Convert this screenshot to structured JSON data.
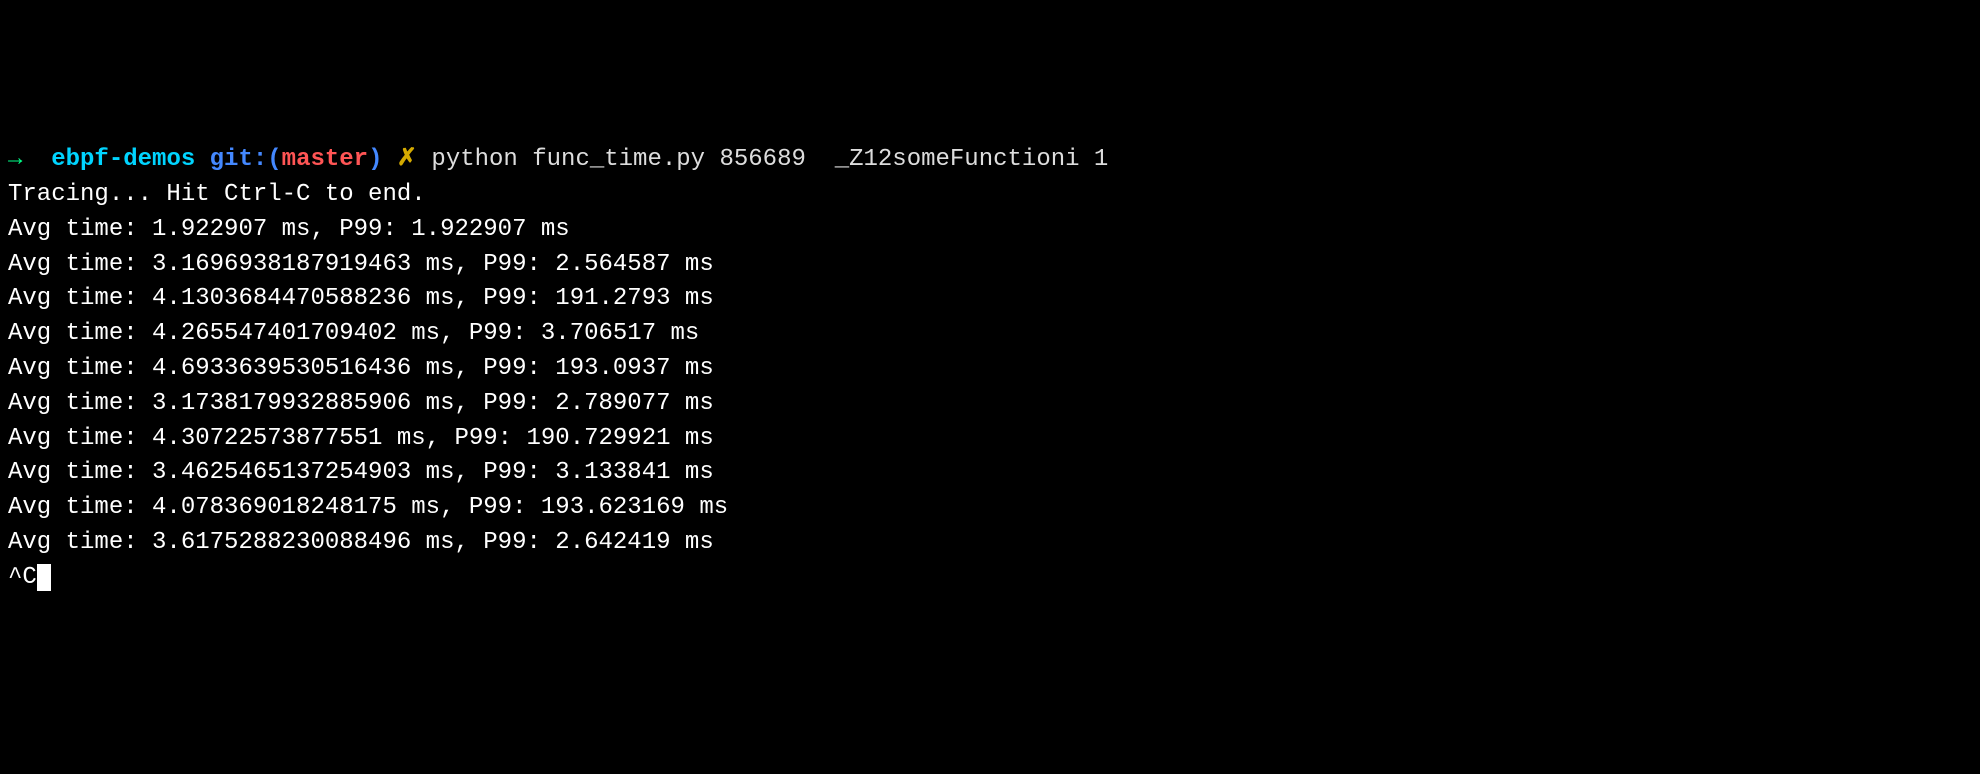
{
  "prompt": {
    "arrow": "→",
    "dir": "ebpf-demos",
    "git_label": "git:(",
    "git_branch": "master",
    "git_close": ")",
    "marker": "✗",
    "command": "python func_time.py 856689  _Z12someFunctioni 1"
  },
  "output": {
    "tracing": "Tracing... Hit Ctrl-C to end.",
    "lines": [
      "Avg time: 1.922907 ms, P99: 1.922907 ms",
      "Avg time: 3.1696938187919463 ms, P99: 2.564587 ms",
      "Avg time: 4.1303684470588236 ms, P99: 191.2793 ms",
      "Avg time: 4.265547401709402 ms, P99: 3.706517 ms",
      "Avg time: 4.6933639530516436 ms, P99: 193.0937 ms",
      "Avg time: 3.1738179932885906 ms, P99: 2.789077 ms",
      "Avg time: 4.30722573877551 ms, P99: 190.729921 ms",
      "Avg time: 3.4625465137254903 ms, P99: 3.133841 ms",
      "Avg time: 4.078369018248175 ms, P99: 193.623169 ms",
      "Avg time: 3.6175288230088496 ms, P99: 2.642419 ms"
    ],
    "interrupt": "^C"
  }
}
